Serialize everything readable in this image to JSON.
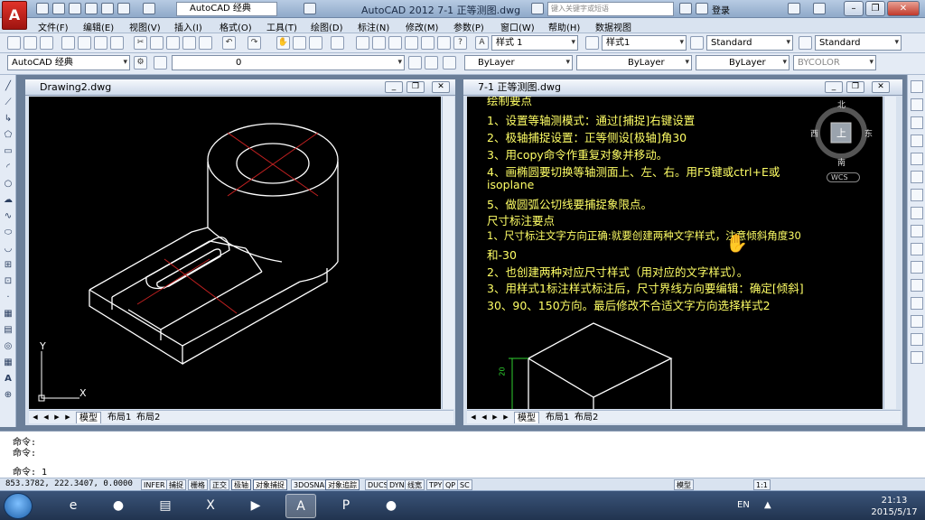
{
  "app": {
    "logo_letter": "A",
    "workspace": "AutoCAD 经典",
    "title": "AutoCAD 2012   7-1 正等测图.dwg",
    "search_placeholder": "键入关键字或短语",
    "login": "登录"
  },
  "menu": [
    "文件(F)",
    "编辑(E)",
    "视图(V)",
    "插入(I)",
    "格式(O)",
    "工具(T)",
    "绘图(D)",
    "标注(N)",
    "修改(M)",
    "参数(P)",
    "窗口(W)",
    "帮助(H)",
    "数据视图"
  ],
  "toolbar1": {
    "text_style": "样式 1",
    "dim_style": "样式1",
    "table_style": "Standard",
    "mleader_style": "Standard"
  },
  "toolbar2": {
    "workspace": "AutoCAD 经典",
    "layer": "0",
    "color": "ByLayer",
    "linetype": "ByLayer",
    "lineweight": "ByLayer",
    "plotstyle": "BYCOLOR"
  },
  "left_window": {
    "title": "Drawing2.dwg",
    "tabs": [
      "模型",
      "布局1",
      "布局2"
    ],
    "ucs": {
      "y": "Y",
      "x": "X"
    }
  },
  "right_window": {
    "title": "7-1 正等测图.dwg",
    "tabs": [
      "模型",
      "布局1",
      "布局2"
    ],
    "viewcube": {
      "north": "北",
      "west": "西",
      "east": "东",
      "south": "南",
      "top": "上",
      "wcs": "WCS"
    },
    "notes": [
      "绘制要点",
      "1、设置等轴测模式：通过[捕捉]右键设置",
      "2、极轴捕捉设置：正等侧设[极轴]角30",
      "3、用copy命令作重复对象并移动。",
      "4、画椭圆要切换等轴测面上、左、右。用F5键或ctrl+E或",
      "isoplane",
      "5、做圆弧公切线要捕捉象限点。",
      "尺寸标注要点",
      "1、尺寸标注文字方向正确:就要创建两种文字样式，注意倾斜角度30",
      "和-30",
      "2、也创建两种对应尺寸样式（用对应的文字样式）。",
      "3、用样式1标注样式标注后，尺寸界线方向要编辑：确定[倾斜]",
      "30、90、150方向。最后修改不合适文字方向选择样式2"
    ],
    "dim_text": "20"
  },
  "command": {
    "lines": [
      "命令:",
      "命令:"
    ],
    "prompt": "命令: 1"
  },
  "status": {
    "coords": "853.3782, 222.3407, 0.0000",
    "buttons": [
      "INFER",
      "捕捉",
      "栅格",
      "正交",
      "极轴",
      "对象捕捉",
      "3DOSNAP",
      "对象追踪",
      "DUCS",
      "DYN",
      "线宽",
      "TPY",
      "QP",
      "SC"
    ],
    "model": "模型",
    "scale": "1:1"
  },
  "taskbar": {
    "lang": "EN",
    "time": "21:13",
    "date": "2015/5/17"
  }
}
